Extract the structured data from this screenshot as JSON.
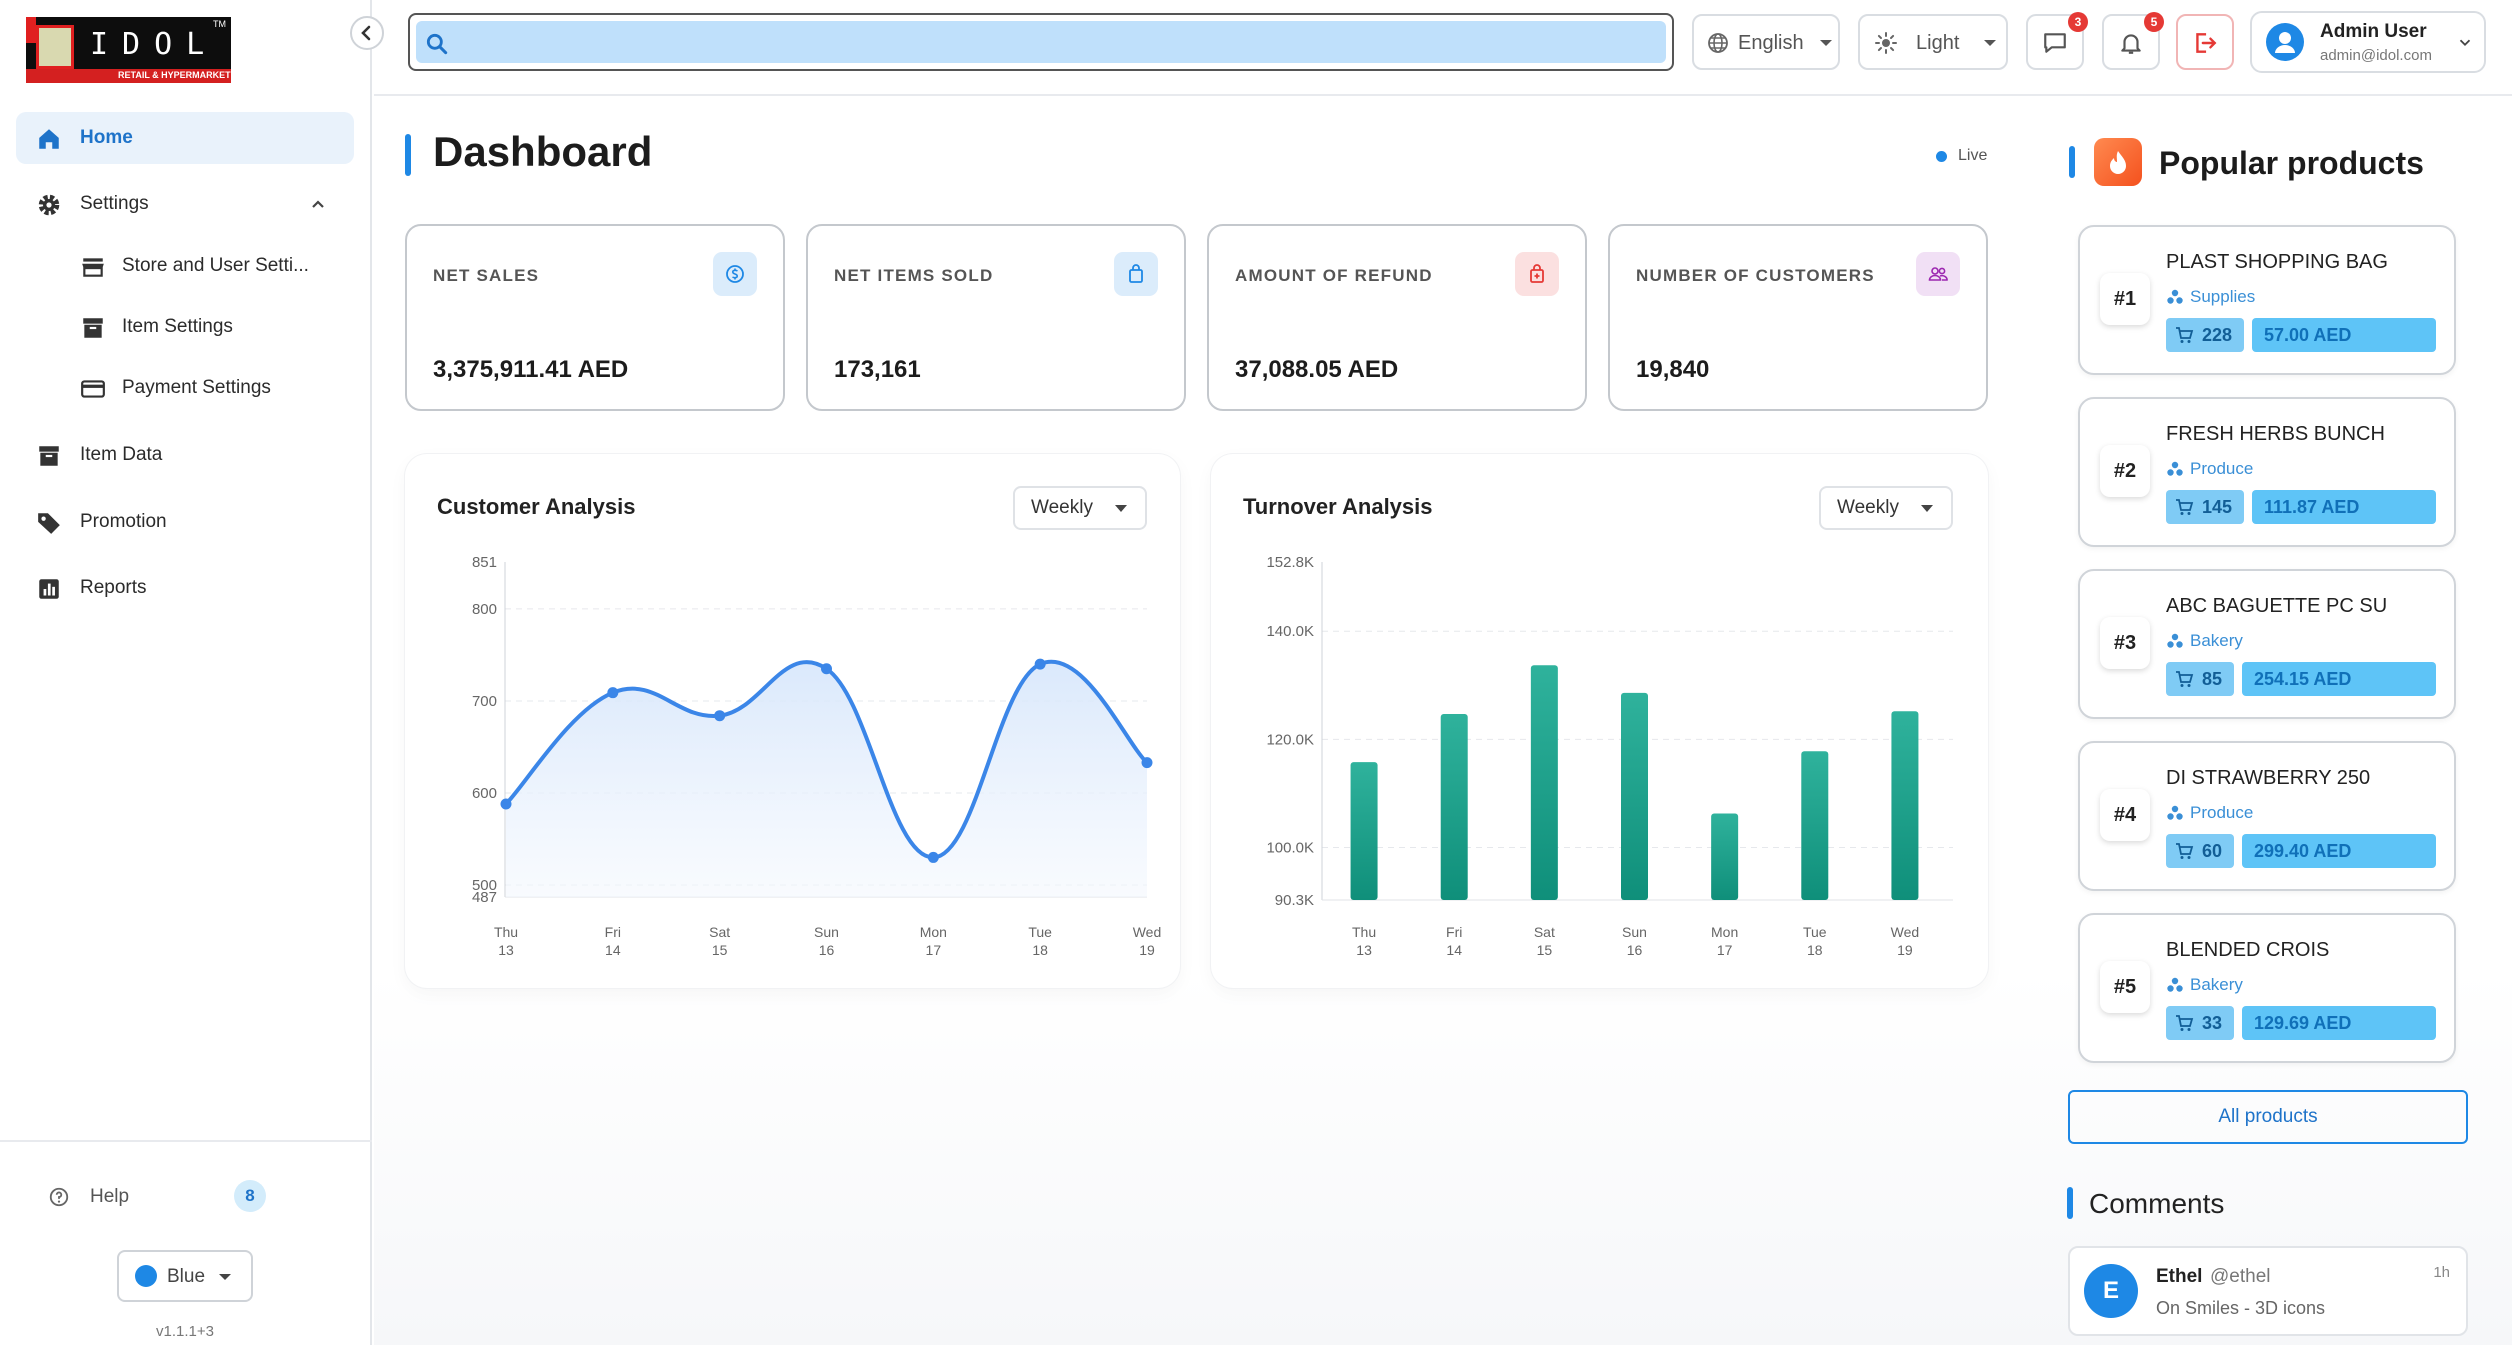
{
  "brand": {
    "logo_text": "IDOL",
    "logo_tagline": "RETAIL & HYPERMARKET",
    "logo_tm": "TM"
  },
  "sidebar": {
    "items": [
      {
        "label": "Home",
        "icon": "home-icon",
        "active": true
      },
      {
        "label": "Settings",
        "icon": "gear-icon",
        "expanded": true
      },
      {
        "label": "Store and User Setti...",
        "icon": "store-icon"
      },
      {
        "label": "Item Settings",
        "icon": "archive-icon"
      },
      {
        "label": "Payment Settings",
        "icon": "credit-card-icon"
      },
      {
        "label": "Item Data",
        "icon": "archive-icon"
      },
      {
        "label": "Promotion",
        "icon": "tag-icon"
      },
      {
        "label": "Reports",
        "icon": "bar-chart-icon"
      }
    ],
    "help_label": "Help",
    "help_count": "8",
    "theme_label": "Blue",
    "theme_color": "#1e88e5",
    "version": "v1.1.1+3"
  },
  "header": {
    "search_placeholder": "",
    "language": "English",
    "theme_mode": "Light",
    "messages_count": "3",
    "notifications_count": "5",
    "user_name": "Admin User",
    "user_email": "admin@idol.com"
  },
  "dashboard": {
    "title": "Dashboard",
    "live_label": "Live",
    "stats": [
      {
        "label": "NET SALES",
        "value": "3,375,911.41 AED",
        "icon": "dollar-circle-icon",
        "color": "#1e88e5"
      },
      {
        "label": "NET ITEMS SOLD",
        "value": "173,161",
        "icon": "shopping-bag-icon",
        "color": "#1e88e5"
      },
      {
        "label": "AMOUNT OF REFUND",
        "value": "37,088.05 AED",
        "icon": "refund-icon",
        "color": "#e53935"
      },
      {
        "label": "NUMBER OF CUSTOMERS",
        "value": "19,840",
        "icon": "users-icon",
        "color": "#9c27b0"
      }
    ]
  },
  "chart_data": [
    {
      "type": "area",
      "title": "Customer Analysis",
      "period": "Weekly",
      "categories": [
        "Thu 13",
        "Fri 14",
        "Sat 15",
        "Sun 16",
        "Mon 17",
        "Tue 18",
        "Wed 19"
      ],
      "x_tick_labels": [
        [
          "Thu",
          "13"
        ],
        [
          "Fri",
          "14"
        ],
        [
          "Sat",
          "15"
        ],
        [
          "Sun",
          "16"
        ],
        [
          "Mon",
          "17"
        ],
        [
          "Tue",
          "18"
        ],
        [
          "Wed",
          "19"
        ]
      ],
      "values": [
        588,
        709,
        684,
        735,
        530,
        740,
        633
      ],
      "ylim": [
        487,
        851
      ],
      "y_ticks": [
        487,
        500,
        600,
        700,
        800,
        851
      ],
      "grid": true,
      "color": "#3b86e8"
    },
    {
      "type": "bar",
      "title": "Turnover Analysis",
      "period": "Weekly",
      "categories": [
        "Thu 13",
        "Fri 14",
        "Sat 15",
        "Sun 16",
        "Mon 17",
        "Tue 18",
        "Wed 19"
      ],
      "x_tick_labels": [
        [
          "Thu",
          "13"
        ],
        [
          "Fri",
          "14"
        ],
        [
          "Sat",
          "15"
        ],
        [
          "Sun",
          "16"
        ],
        [
          "Mon",
          "17"
        ],
        [
          "Tue",
          "18"
        ],
        [
          "Wed",
          "19"
        ]
      ],
      "values": [
        115800,
        124700,
        133700,
        128600,
        106300,
        117800,
        125200
      ],
      "ylim": [
        90300,
        152800
      ],
      "y_ticks": [
        {
          "v": 90300,
          "label": "90.3K"
        },
        {
          "v": 100000,
          "label": "100.0K"
        },
        {
          "v": 120000,
          "label": "120.0K"
        },
        {
          "v": 140000,
          "label": "140.0K"
        },
        {
          "v": 152800,
          "label": "152.8K"
        }
      ],
      "grid": true,
      "color": "#1a9e8a"
    }
  ],
  "popular": {
    "title": "Popular products",
    "items": [
      {
        "rank": "#1",
        "name": "PLAST SHOPPING BAG",
        "category": "Supplies",
        "qty": "228",
        "price": "57.00 AED"
      },
      {
        "rank": "#2",
        "name": "FRESH HERBS BUNCH",
        "category": "Produce",
        "qty": "145",
        "price": "111.87 AED"
      },
      {
        "rank": "#3",
        "name": "ABC BAGUETTE PC SU",
        "category": "Bakery",
        "qty": "85",
        "price": "254.15 AED"
      },
      {
        "rank": "#4",
        "name": "DI STRAWBERRY 250",
        "category": "Produce",
        "qty": "60",
        "price": "299.40 AED"
      },
      {
        "rank": "#5",
        "name": "BLENDED CROIS",
        "category": "Bakery",
        "qty": "33",
        "price": "129.69 AED"
      }
    ],
    "all_products_label": "All products"
  },
  "comments": {
    "title": "Comments",
    "items": [
      {
        "initial": "E",
        "name": "Ethel",
        "handle": "@ethel",
        "text": "On Smiles - 3D icons",
        "time": "1h"
      }
    ]
  }
}
